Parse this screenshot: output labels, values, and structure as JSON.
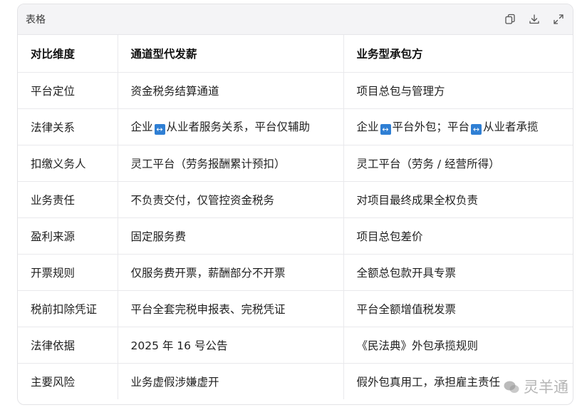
{
  "panel": {
    "title": "表格",
    "actions": [
      "copy-icon",
      "download-icon",
      "expand-icon"
    ]
  },
  "table": {
    "headers": [
      "对比维度",
      "通道型代发薪",
      "业务型承包方"
    ],
    "rows": [
      {
        "dim": "平台定位",
        "channel": "资金税务结算通道",
        "contract": "项目总包与管理方"
      },
      {
        "dim": "法律关系",
        "channel": "从业者服务关系，平台仅辅助",
        "channel_prefix": "企业",
        "contract_a": "企业",
        "contract_b": "平台外包；平台",
        "contract_c": "从业者承揽"
      },
      {
        "dim": "扣缴义务人",
        "channel": "灵工平台（劳务报酬累计预扣）",
        "contract": "灵工平台（劳务 / 经营所得）"
      },
      {
        "dim": "业务责任",
        "channel": "不负责交付，仅管控资金税务",
        "contract": "对项目最终成果全权负责"
      },
      {
        "dim": "盈利来源",
        "channel": "固定服务费",
        "contract": "项目总包差价"
      },
      {
        "dim": "开票规则",
        "channel": "仅服务费开票，薪酬部分不开票",
        "contract": "全额总包款开具专票"
      },
      {
        "dim": "税前扣除凭证",
        "channel": "平台全套完税申报表、完税凭证",
        "contract": "平台全额增值税发票"
      },
      {
        "dim": "法律依据",
        "channel": "2025 年 16 号公告",
        "contract": "《民法典》外包承揽规则"
      },
      {
        "dim": "主要风险",
        "channel": "业务虚假涉嫌虚开",
        "contract": "假外包真用工，承担雇主责任"
      }
    ]
  },
  "watermark": {
    "text": "灵羊通"
  },
  "colors": {
    "arrow_badge": "#2f7fd4",
    "header_bg": "#f4f4f6",
    "border": "#e9e9ec"
  }
}
